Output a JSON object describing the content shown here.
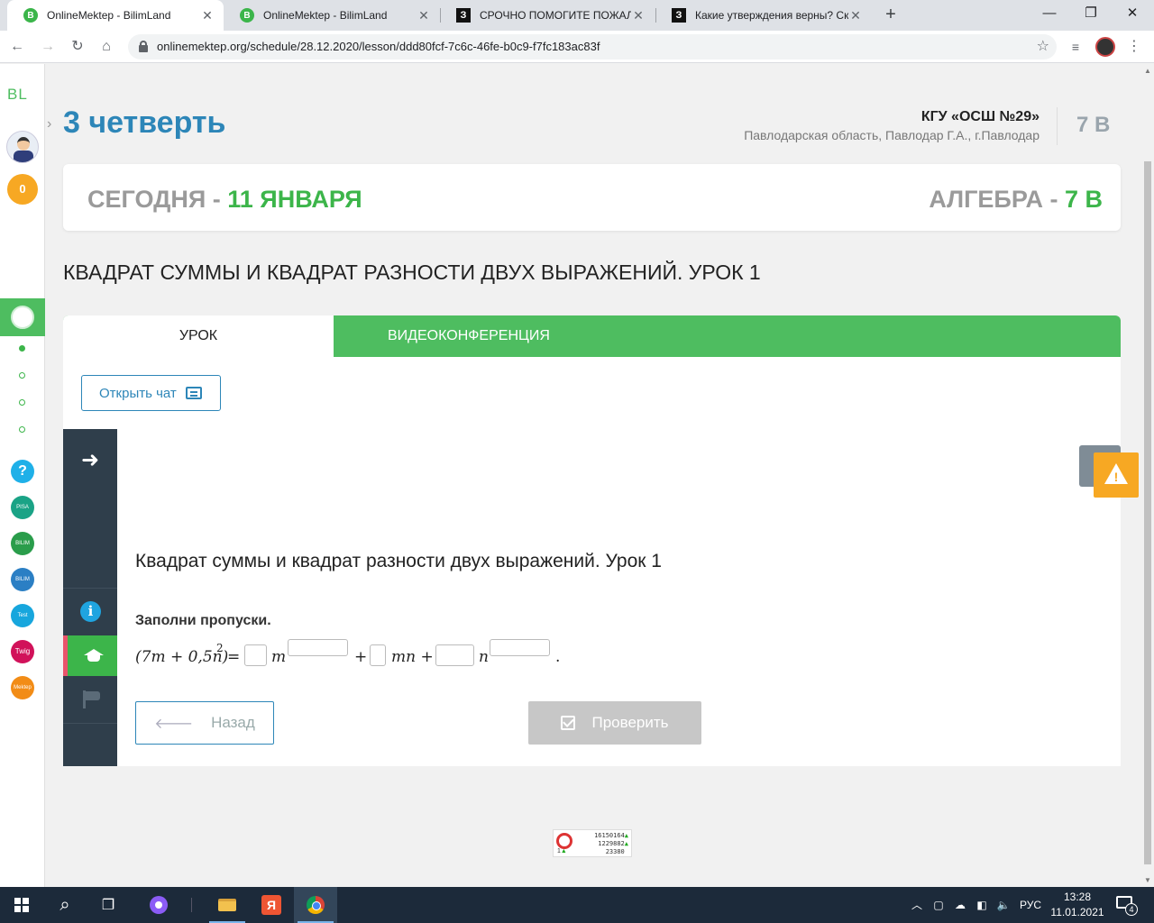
{
  "browser": {
    "tabs": [
      {
        "title": "OnlineMektep - BilimLand",
        "favicon": "B",
        "active": true
      },
      {
        "title": "OnlineMektep - BilimLand",
        "favicon": "B",
        "active": false
      },
      {
        "title": "СРОЧНО ПОМОГИТЕ ПОЖАЛУЙ",
        "favicon": "З",
        "active": false
      },
      {
        "title": "Какие утверждения верны? Ско",
        "favicon": "З",
        "active": false
      }
    ],
    "new_tab_label": "+",
    "url": "onlinemektep.org/schedule/28.12.2020/lesson/ddd80fcf-7c6c-46fe-b0c9-f7fc183ac83f",
    "controls": {
      "minimize": "—",
      "restore": "❐",
      "close": "✕"
    },
    "nav": {
      "back": "←",
      "forward": "→",
      "reload": "↻",
      "home": "⌂"
    }
  },
  "sidebar": {
    "logo": "BL",
    "coins": "0",
    "toggle": "›",
    "apps": [
      {
        "name": "help",
        "label": "?",
        "color": "#1fb0e8"
      },
      {
        "name": "pisa",
        "label": "PISA",
        "color": "#1aa386"
      },
      {
        "name": "bilimland",
        "label": "BILIM Land",
        "color": "#2a9d4b"
      },
      {
        "name": "bilimbook",
        "label": "BILIM Book",
        "color": "#2b7fc4"
      },
      {
        "name": "test",
        "label": "Test",
        "color": "#17a6dd"
      },
      {
        "name": "twig",
        "label": "Twig",
        "color": "#d1125a"
      },
      {
        "name": "mektep",
        "label": "Mektep",
        "color": "#f28c16"
      }
    ]
  },
  "page": {
    "quarter_title": "3 четверть",
    "school_name": "КГУ «ОСШ №29»",
    "school_region": "Павлодарская область, Павлодар Г.А., г.Павлодар",
    "grade": "7 В",
    "date_prefix": "СЕГОДНЯ - ",
    "date_value": "11 ЯНВАРЯ",
    "subject_prefix": "АЛГЕБРА - ",
    "subject_grade": "7 В",
    "lesson_title": "КВАДРАТ СУММЫ И КВАДРАТ РАЗНОСТИ ДВУХ ВЫРАЖЕНИЙ. УРОК 1",
    "tabs": {
      "lesson": "УРОК",
      "video": "ВИДЕОКОНФЕРЕНЦИЯ"
    },
    "chat_button": "Открыть чат"
  },
  "task": {
    "title": "Квадрат суммы и квадрат разности двух выражений. Урок 1",
    "instruction": "Заполни пропуски.",
    "equation": {
      "lhs": "(7m + 0,5n)",
      "lhs_exp": "2",
      "eq": "=",
      "m": "m",
      "plus1": "+",
      "mn": "mn +",
      "n": "n",
      "end": "."
    },
    "back_button": "Назад",
    "check_button": "Проверить",
    "side_icons": {
      "next": "➜",
      "info": "i"
    }
  },
  "counter": {
    "lines": [
      "16150164",
      "1229882",
      "23380"
    ],
    "left": "1"
  },
  "taskbar": {
    "language": "РУС",
    "time": "13:28",
    "date": "11.01.2021",
    "notifications": "4",
    "search_icon": "⌕",
    "taskview_icon": "❐"
  }
}
